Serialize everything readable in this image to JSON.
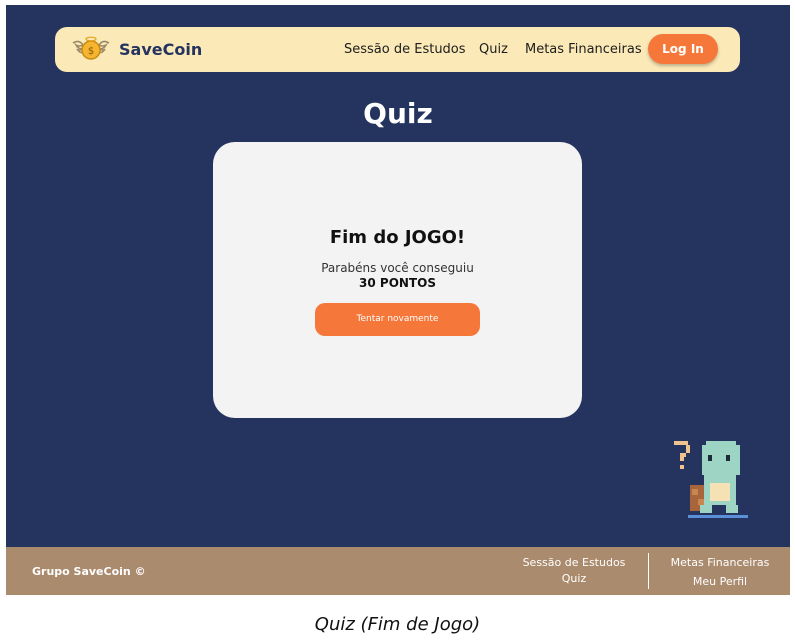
{
  "navbar": {
    "brand": "SaveCoin",
    "links": [
      "Sessão de Estudos",
      "Quiz",
      "Metas Financeiras"
    ],
    "login_label": "Log In"
  },
  "page": {
    "title": "Quiz"
  },
  "result_card": {
    "title": "Fim do JOGO!",
    "message": "Parabéns você conseguiu",
    "score": "30 PONTOS",
    "retry_label": "Tentar novamente"
  },
  "footer": {
    "brand": "Grupo SaveCoin ©",
    "links_left": [
      "Sessão de Estudos",
      "Quiz"
    ],
    "links_right": [
      "Metas Financeiras",
      "Meu Perfil"
    ]
  },
  "caption": "Quiz (Fim de Jogo)",
  "colors": {
    "background": "#25345f",
    "navbar": "#fbe9b7",
    "accent": "#f5783a",
    "card": "#f3f3f3",
    "footer": "#ab8b6e"
  }
}
